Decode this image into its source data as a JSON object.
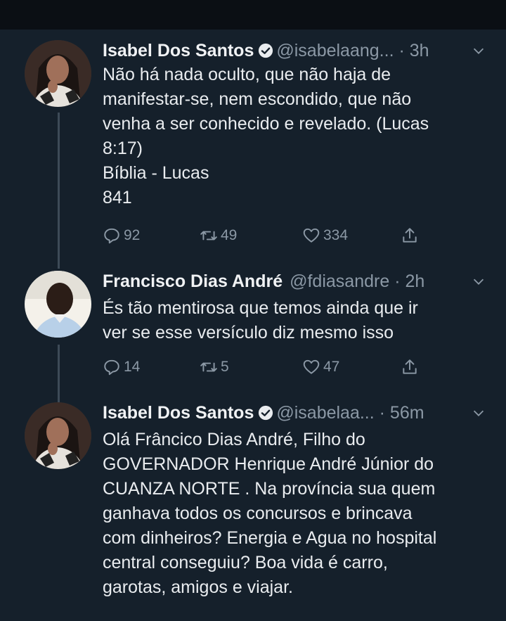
{
  "tweets": [
    {
      "name": "Isabel Dos Santos",
      "handle": "@isabelaang...",
      "time": "3h",
      "lines": [
        "Não há nada oculto, que não haja de",
        "manifestar-se, nem escondido, que não",
        "venha a ser conhecido e revelado. (Lucas",
        "8:17)",
        "Bíblia - Lucas",
        "841"
      ],
      "replies": "92",
      "retweets": "49",
      "likes": "334"
    },
    {
      "name": "Francisco Dias André",
      "handle": "@fdiasandre",
      "time": "2h",
      "lines": [
        "És tão mentirosa que temos ainda que ir",
        "ver se esse versículo diz mesmo isso"
      ],
      "replies": "14",
      "retweets": "5",
      "likes": "47"
    },
    {
      "name": "Isabel Dos Santos",
      "handle": "@isabelaa...",
      "time": "56m",
      "lines": [
        "Olá Frâncico Dias André, Filho do",
        "GOVERNADOR Henrique André Júnior do",
        "CUANZA NORTE . Na província sua quem",
        "ganhava todos os concursos e brincava",
        "com dinheiros?  Energia e Agua no hospital",
        "central conseguiu? Boa vida é carro,",
        "garotas, amigos e viajar."
      ]
    }
  ],
  "colors": {
    "background": "#15202b",
    "text": "#e9ecef",
    "muted": "#8b98a5",
    "thread_line": "#3d4a57"
  },
  "icons": [
    "verified-icon",
    "chevron-down-icon",
    "reply-icon",
    "retweet-icon",
    "like-icon",
    "share-icon"
  ]
}
